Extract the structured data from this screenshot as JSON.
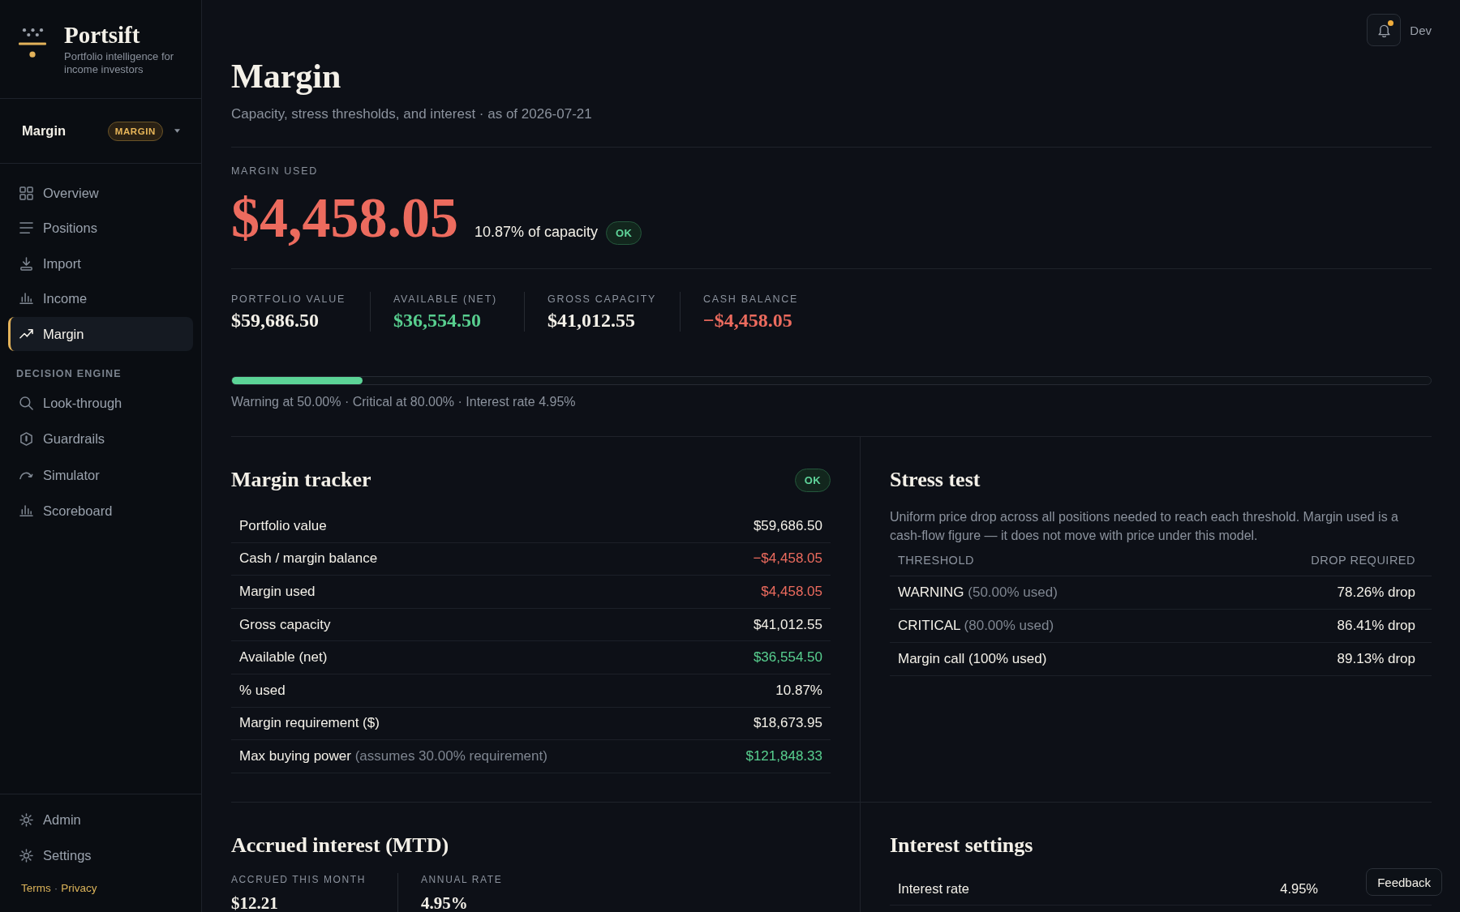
{
  "sidebar": {
    "brand": {
      "name": "Portsift",
      "tagline": "Portfolio intelligence for income investors"
    },
    "account": {
      "name": "Margin",
      "badge": "MARGIN"
    },
    "nav": [
      {
        "label": "Overview",
        "selected": false
      },
      {
        "label": "Positions",
        "selected": false
      },
      {
        "label": "Import",
        "selected": false
      },
      {
        "label": "Income",
        "selected": false
      },
      {
        "label": "Margin",
        "selected": true
      }
    ],
    "sections": [
      {
        "title": "DECISION ENGINE",
        "items": [
          {
            "label": "Look-through",
            "selected": false
          },
          {
            "label": "Guardrails",
            "selected": false
          },
          {
            "label": "Simulator",
            "selected": false
          },
          {
            "label": "Scoreboard",
            "selected": false
          }
        ]
      }
    ],
    "footer_nav": [
      {
        "label": "Admin",
        "selected": false
      },
      {
        "label": "Settings",
        "selected": false
      }
    ],
    "legal": {
      "links": [
        "Terms",
        "Privacy"
      ],
      "separator": "·"
    }
  },
  "topbar": {
    "notifications": {
      "unread": true
    },
    "user": "Dev"
  },
  "header": {
    "title": "Margin",
    "subtitle": "Capacity, stress thresholds, and interest · as of 2026-07-21"
  },
  "margin_used": {
    "label": "MARGIN USED",
    "value": "$4,458.05",
    "color": "#ec6b5e",
    "share": "10.87% of capacity",
    "status": {
      "label": "OK",
      "kind": "ok"
    }
  },
  "stats": [
    {
      "label": "PORTFOLIO VALUE",
      "value": "$59,686.50",
      "color": "#f3f0e8"
    },
    {
      "label": "AVAILABLE (NET)",
      "value": "$36,554.50",
      "color": "#58cf8f"
    },
    {
      "label": "GROSS CAPACITY",
      "value": "$41,012.55",
      "color": "#f3f0e8"
    },
    {
      "label": "CASH BALANCE",
      "value": "−$4,458.05",
      "color": "#ec6b5e"
    }
  ],
  "utilization": {
    "level": 0.1087,
    "caption": "Warning at 50.00% · Critical at 80.00% · Interest rate 4.95%"
  },
  "margin_tracker": {
    "title": "Margin tracker",
    "status": {
      "label": "OK",
      "kind": "ok"
    },
    "rows": [
      {
        "label": "Portfolio value",
        "value": "$59,686.50",
        "color": "#f3f0e8"
      },
      {
        "label": "Cash / margin balance",
        "value": "−$4,458.05",
        "color": "#ec6b5e"
      },
      {
        "label": "Margin used",
        "value": "$4,458.05",
        "color": "#ec6b5e"
      },
      {
        "label": "Gross capacity",
        "value": "$41,012.55",
        "color": "#f3f0e8"
      },
      {
        "label": "Available (net)",
        "value": "$36,554.50",
        "color": "#58cf8f"
      },
      {
        "label": "% used",
        "value": "10.87%",
        "color": "#f3f0e8"
      },
      {
        "label": "Margin requirement ($)",
        "value": "$18,673.95",
        "color": "#f3f0e8"
      },
      {
        "label": "Max buying power",
        "note": "(assumes 30.00% requirement)",
        "value": "$121,848.33",
        "color": "#58cf8f"
      }
    ]
  },
  "stress_test": {
    "title": "Stress test",
    "description": "Uniform price drop across all positions needed to reach each threshold. Margin used is a cash-flow figure — it does not move with price under this model.",
    "columns": [
      "THRESHOLD",
      "DROP REQUIRED"
    ],
    "rows": [
      {
        "threshold": "WARNING",
        "note": "(50.00% used)",
        "drop": "78.26% drop"
      },
      {
        "threshold": "CRITICAL",
        "note": "(80.00% used)",
        "drop": "86.41% drop"
      },
      {
        "threshold": "Margin call (100% used)",
        "drop": "89.13% drop"
      }
    ]
  },
  "accrued_interest": {
    "title": "Accrued interest (MTD)",
    "stats": [
      {
        "label": "ACCRUED THIS MONTH",
        "value": "$12.21"
      },
      {
        "label": "ANNUAL RATE",
        "value": "4.95%"
      }
    ]
  },
  "interest_settings": {
    "title": "Interest settings",
    "rows": [
      {
        "label": "Interest rate",
        "value": "4.95%"
      }
    ]
  },
  "feedback": {
    "label": "Feedback"
  }
}
